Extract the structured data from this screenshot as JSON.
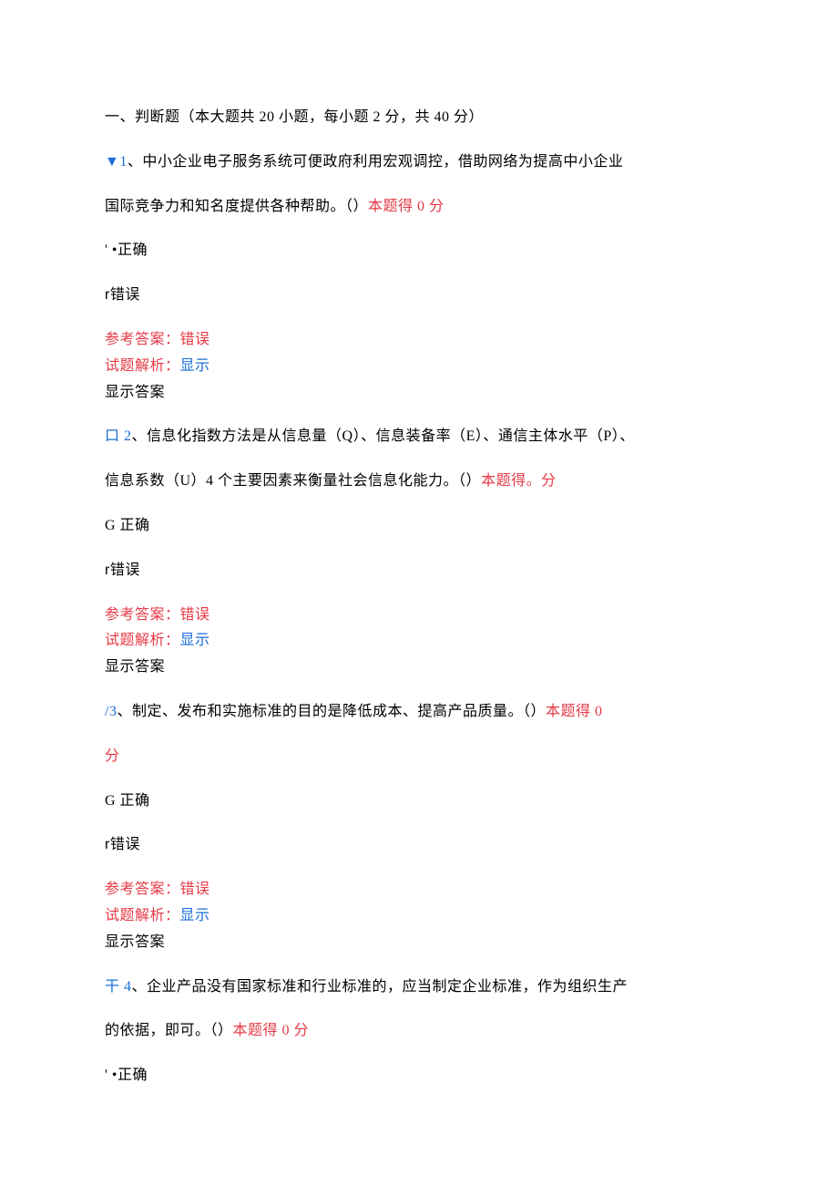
{
  "section_header": "一、判断题（本大题共 20 小题，每小题 2 分，共 40 分）",
  "q1": {
    "prefix": "▼1",
    "text_a": "、中小企业电子服务系统可便政府利用宏观调控，借助网络为提高中小企业",
    "text_b": "国际竞争力和知名度提供各种帮助。（）",
    "score": "本题得 0 分",
    "opt_correct": "' •正确",
    "opt_wrong_marker": "r",
    "opt_wrong": "错误",
    "ref_label": "参考答案：",
    "ref_value": "错误",
    "analysis_label": "试题解析：",
    "analysis_link": "显示",
    "show_answer": "显示答案"
  },
  "q2": {
    "prefix": "口 2",
    "text_a": "、信息化指数方法是从信息量（Q）、信息装备率（E）、通信主体水平（P）、",
    "text_b": "信息系数（U）4 个主要因素来衡量社会信息化能力。（）",
    "score": "本题得。分",
    "opt_correct": "G 正确",
    "opt_wrong_marker": "r",
    "opt_wrong": "错误",
    "ref_label": "参考答案：",
    "ref_value": "错误",
    "analysis_label": "试题解析：",
    "analysis_link": "显示",
    "show_answer": "显示答案"
  },
  "q3": {
    "prefix": "/3",
    "text_a": "、制定、发布和实施标准的目的是降低成本、提高产品质量。（）",
    "score_a": "本题得 0",
    "score_b": "分",
    "opt_correct": "G 正确",
    "opt_wrong_marker": "r",
    "opt_wrong": "错误",
    "ref_label": "参考答案：",
    "ref_value": "错误",
    "analysis_label": "试题解析：",
    "analysis_link": "显示",
    "show_answer": "显示答案"
  },
  "q4": {
    "prefix": "干 4",
    "text_a": "、企业产品没有国家标准和行业标准的，应当制定企业标准，作为组织生产",
    "text_b": "的依据，即可。（）",
    "score": "本题得 0 分",
    "opt_correct": "' •正确"
  }
}
